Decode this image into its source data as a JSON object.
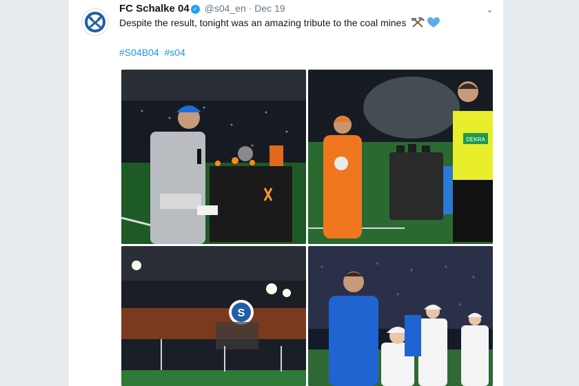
{
  "tweet": {
    "author_name": "FC Schalke 04",
    "handle": "@s04_en",
    "separator": "·",
    "date": "Dec 19",
    "text": "Despite the result, tonight was an amazing tribute to the coal mines",
    "emoji": [
      "hammer-and-pick-icon",
      "blue-heart-icon"
    ],
    "hashtags": [
      "#S04B04",
      "#s04"
    ]
  },
  "photos": [
    {
      "name": "miner-with-microphone-photo"
    },
    {
      "name": "man-in-orange-suit-with-ball-photo"
    },
    {
      "name": "stadium-schalke-logo-photo"
    },
    {
      "name": "player-with-mascots-photo",
      "sponsor_text": "DEKRA"
    }
  ],
  "colors": {
    "link": "#1b95e0",
    "verified": "#1da1f2",
    "background": "#e6ecf0"
  }
}
